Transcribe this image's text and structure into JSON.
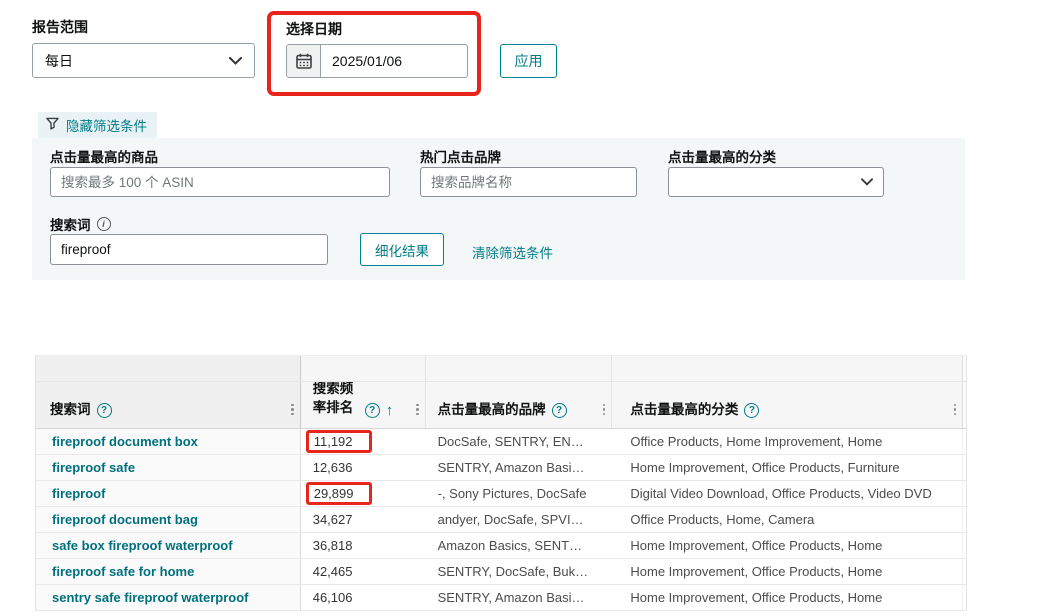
{
  "controls": {
    "report_range_label": "报告范围",
    "report_range_value": "每日",
    "date_label": "选择日期",
    "date_value": "2025/01/06",
    "apply_label": "应用"
  },
  "filters": {
    "toggle_label": "隐藏筛选条件",
    "top_products_label": "点击量最高的商品",
    "top_products_placeholder": "搜索最多 100 个 ASIN",
    "top_brands_label": "热门点击品牌",
    "top_brands_placeholder": "搜索品牌名称",
    "top_categories_label": "点击量最高的分类",
    "search_term_label": "搜索词",
    "search_term_value": "fireproof",
    "refine_label": "细化结果",
    "clear_label": "清除筛选条件"
  },
  "table": {
    "header": {
      "term": "搜索词",
      "rank": "搜索频率排名",
      "brands": "点击量最高的品牌",
      "categories": "点击量最高的分类"
    },
    "rows": [
      {
        "term": "fireproof document box",
        "rank": "11,192",
        "rank_highlight": true,
        "brands": "DocSafe, SENTRY, EN…",
        "categories": "Office Products, Home Improvement, Home"
      },
      {
        "term": "fireproof safe",
        "rank": "12,636",
        "rank_highlight": false,
        "brands": "SENTRY, Amazon Basi…",
        "categories": "Home Improvement, Office Products, Furniture"
      },
      {
        "term": "fireproof",
        "rank": "29,899",
        "rank_highlight": true,
        "brands": "-, Sony Pictures, DocSafe",
        "categories": "Digital Video Download, Office Products, Video DVD"
      },
      {
        "term": "fireproof document bag",
        "rank": "34,627",
        "rank_highlight": false,
        "brands": "andyer, DocSafe, SPVI…",
        "categories": "Office Products, Home, Camera"
      },
      {
        "term": "safe box fireproof waterproof",
        "rank": "36,818",
        "rank_highlight": false,
        "brands": "Amazon Basics, SENT…",
        "categories": "Home Improvement, Office Products, Home"
      },
      {
        "term": "fireproof safe for home",
        "rank": "42,465",
        "rank_highlight": false,
        "brands": "SENTRY, DocSafe, Buk…",
        "categories": "Home Improvement, Office Products, Home"
      },
      {
        "term": "sentry safe fireproof waterproof",
        "rank": "46,106",
        "rank_highlight": false,
        "brands": "SENTRY, Amazon Basi…",
        "categories": "Home Improvement, Office Products, Home"
      }
    ]
  },
  "colors": {
    "accent_teal": "#007b87",
    "annotation_red": "#e8251c"
  }
}
